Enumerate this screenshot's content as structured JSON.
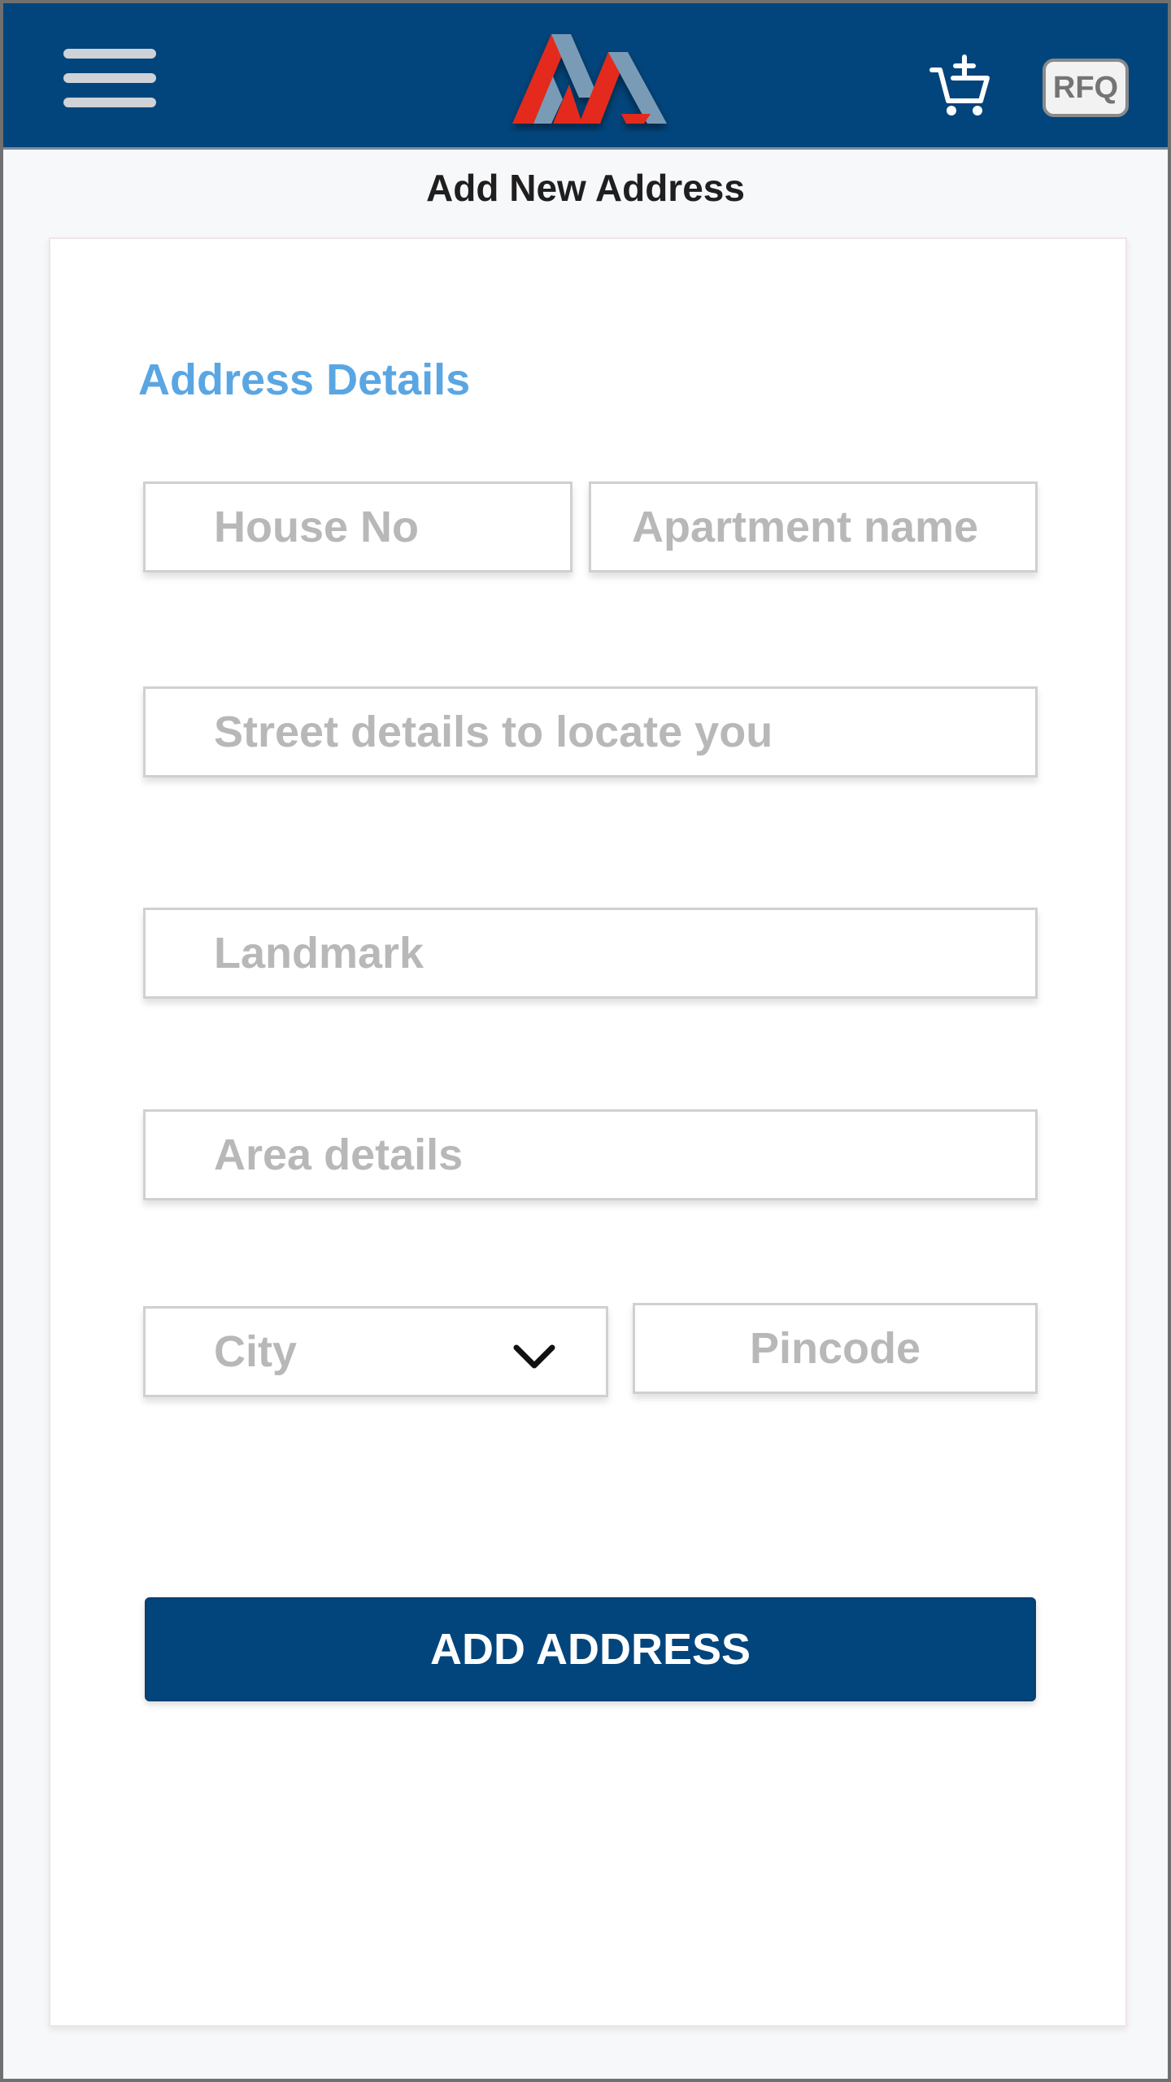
{
  "header": {
    "rfq_label": "RFQ",
    "colors": {
      "background": "#02457c",
      "logo_red": "#e32b1e",
      "logo_blue": "#7a9bb6"
    }
  },
  "page": {
    "title": "Add New Address"
  },
  "form": {
    "section_title": "Address Details",
    "house_no": {
      "value": "",
      "placeholder": "House No"
    },
    "apartment": {
      "value": "",
      "placeholder": "Apartment name"
    },
    "street": {
      "value": "",
      "placeholder": "Street details to locate you"
    },
    "landmark": {
      "value": "",
      "placeholder": "Landmark"
    },
    "area": {
      "value": "",
      "placeholder": "Area details"
    },
    "city": {
      "selected": "City",
      "icon": "chevron-down-icon"
    },
    "pincode": {
      "value": "",
      "placeholder": "Pincode"
    },
    "submit_label": "ADD ADDRESS",
    "accent_color": "#5aa6e3"
  }
}
